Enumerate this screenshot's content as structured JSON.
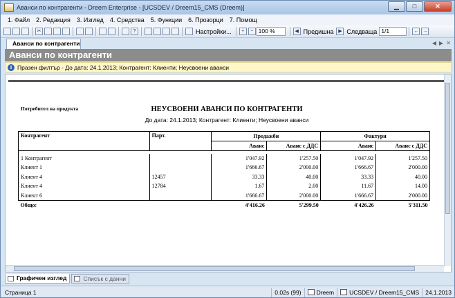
{
  "window": {
    "title": "Аванси по контрагенти - Dreem Enterprise - [UCSDEV / Dreem15_CMS (Dreem)]"
  },
  "menu": [
    "1. Файл",
    "2. Редакция",
    "3. Изглед",
    "4. Средства",
    "5. Функции",
    "6. Прозорци",
    "7. Помощ"
  ],
  "toolbar": {
    "settings_label": "Настройки...",
    "zoom": "100 %",
    "prev_label": "Предишна",
    "next_label": "Следваща",
    "page": "1/1"
  },
  "tab": {
    "label": "Аванси по контрагенти"
  },
  "banner": {
    "title": "Аванси по контрагенти"
  },
  "filter": {
    "text": "Празен филтър - До дата: 24.1.2013; Контрагент: Клиенти; Неусвоени аванси"
  },
  "report": {
    "consumer": "Потребител на продукта",
    "title": "НЕУСВОЕНИ АВАНСИ ПО КОНТРАГЕНТИ",
    "subtitle": "До дата: 24.1.2013; Контрагент: Клиенти; Неусвоени аванси",
    "headers": {
      "contractor": "Контрагент",
      "lot": "Парт.",
      "sales": "Продажби",
      "invoices": "Фактури",
      "advance": "Аванс",
      "advance_vat": "Аванс с ДДС"
    },
    "rows": [
      {
        "contractor": "1 Контрагент",
        "lot": "",
        "sales_adv": "1'047.92",
        "sales_vat": "1'257.50",
        "inv_adv": "1'047.92",
        "inv_vat": "1'257.50"
      },
      {
        "contractor": "Клиент 1",
        "lot": "",
        "sales_adv": "1'666.67",
        "sales_vat": "2'000.00",
        "inv_adv": "1'666.67",
        "inv_vat": "2'000.00"
      },
      {
        "contractor": "Клиент 4",
        "lot": "12457",
        "sales_adv": "33.33",
        "sales_vat": "40.00",
        "inv_adv": "33.33",
        "inv_vat": "40.00"
      },
      {
        "contractor": "Клиент 4",
        "lot": "12784",
        "sales_adv": "1.67",
        "sales_vat": "2.00",
        "inv_adv": "11.67",
        "inv_vat": "14.00"
      },
      {
        "contractor": "Клиент 6",
        "lot": "",
        "sales_adv": "1'666.67",
        "sales_vat": "2'000.00",
        "inv_adv": "1'666.67",
        "inv_vat": "2'000.00"
      }
    ],
    "total": {
      "label": "Общо:",
      "sales_adv": "4'416.26",
      "sales_vat": "5'299.50",
      "inv_adv": "4'426.26",
      "inv_vat": "5'311.50"
    }
  },
  "bottom_tabs": {
    "graphic": "Графичен изглед",
    "data": "Списък с данни"
  },
  "status": {
    "page": "Страница 1",
    "time": "0.02s (99)",
    "user": "Dreem",
    "db": "UCSDEV / Dreem15_CMS",
    "date": "24.1.2013"
  }
}
